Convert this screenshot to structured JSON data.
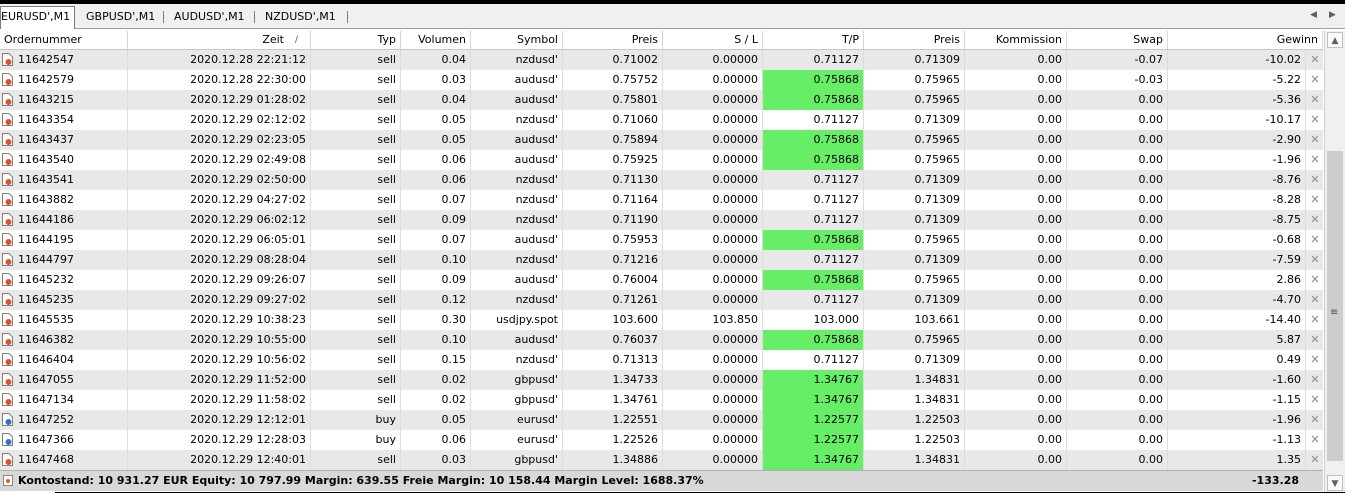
{
  "tabs": [
    {
      "label": "EURUSD',M1",
      "active": true
    },
    {
      "label": "GBPUSD',M1",
      "active": false
    },
    {
      "label": "AUDUSD',M1",
      "active": false
    },
    {
      "label": "NZDUSD',M1",
      "active": false
    }
  ],
  "columns": [
    "Ordernummer",
    "Zeit",
    "Typ",
    "Volumen",
    "Symbol",
    "Preis",
    "S / L",
    "T/P",
    "Preis",
    "Kommission",
    "Swap",
    "Gewinn"
  ],
  "sort_indicator": "/",
  "rows": [
    {
      "order": "11642547",
      "time": "2020.12.28 22:21:12",
      "type": "sell",
      "volume": "0.04",
      "symbol": "nzdusd'",
      "price": "0.71002",
      "sl": "0.00000",
      "tp": "0.71127",
      "tp_hit": false,
      "cur": "0.71309",
      "comm": "0.00",
      "swap": "-0.07",
      "profit": "-10.02",
      "icon": "red"
    },
    {
      "order": "11642579",
      "time": "2020.12.28 22:30:00",
      "type": "sell",
      "volume": "0.03",
      "symbol": "audusd'",
      "price": "0.75752",
      "sl": "0.00000",
      "tp": "0.75868",
      "tp_hit": true,
      "cur": "0.75965",
      "comm": "0.00",
      "swap": "-0.03",
      "profit": "-5.22",
      "icon": "red"
    },
    {
      "order": "11643215",
      "time": "2020.12.29 01:28:02",
      "type": "sell",
      "volume": "0.04",
      "symbol": "audusd'",
      "price": "0.75801",
      "sl": "0.00000",
      "tp": "0.75868",
      "tp_hit": true,
      "cur": "0.75965",
      "comm": "0.00",
      "swap": "0.00",
      "profit": "-5.36",
      "icon": "red"
    },
    {
      "order": "11643354",
      "time": "2020.12.29 02:12:02",
      "type": "sell",
      "volume": "0.05",
      "symbol": "nzdusd'",
      "price": "0.71060",
      "sl": "0.00000",
      "tp": "0.71127",
      "tp_hit": false,
      "cur": "0.71309",
      "comm": "0.00",
      "swap": "0.00",
      "profit": "-10.17",
      "icon": "red"
    },
    {
      "order": "11643437",
      "time": "2020.12.29 02:23:05",
      "type": "sell",
      "volume": "0.05",
      "symbol": "audusd'",
      "price": "0.75894",
      "sl": "0.00000",
      "tp": "0.75868",
      "tp_hit": true,
      "cur": "0.75965",
      "comm": "0.00",
      "swap": "0.00",
      "profit": "-2.90",
      "icon": "red"
    },
    {
      "order": "11643540",
      "time": "2020.12.29 02:49:08",
      "type": "sell",
      "volume": "0.06",
      "symbol": "audusd'",
      "price": "0.75925",
      "sl": "0.00000",
      "tp": "0.75868",
      "tp_hit": true,
      "cur": "0.75965",
      "comm": "0.00",
      "swap": "0.00",
      "profit": "-1.96",
      "icon": "red"
    },
    {
      "order": "11643541",
      "time": "2020.12.29 02:50:00",
      "type": "sell",
      "volume": "0.06",
      "symbol": "nzdusd'",
      "price": "0.71130",
      "sl": "0.00000",
      "tp": "0.71127",
      "tp_hit": false,
      "cur": "0.71309",
      "comm": "0.00",
      "swap": "0.00",
      "profit": "-8.76",
      "icon": "red"
    },
    {
      "order": "11643882",
      "time": "2020.12.29 04:27:02",
      "type": "sell",
      "volume": "0.07",
      "symbol": "nzdusd'",
      "price": "0.71164",
      "sl": "0.00000",
      "tp": "0.71127",
      "tp_hit": false,
      "cur": "0.71309",
      "comm": "0.00",
      "swap": "0.00",
      "profit": "-8.28",
      "icon": "red"
    },
    {
      "order": "11644186",
      "time": "2020.12.29 06:02:12",
      "type": "sell",
      "volume": "0.09",
      "symbol": "nzdusd'",
      "price": "0.71190",
      "sl": "0.00000",
      "tp": "0.71127",
      "tp_hit": false,
      "cur": "0.71309",
      "comm": "0.00",
      "swap": "0.00",
      "profit": "-8.75",
      "icon": "red"
    },
    {
      "order": "11644195",
      "time": "2020.12.29 06:05:01",
      "type": "sell",
      "volume": "0.07",
      "symbol": "audusd'",
      "price": "0.75953",
      "sl": "0.00000",
      "tp": "0.75868",
      "tp_hit": true,
      "cur": "0.75965",
      "comm": "0.00",
      "swap": "0.00",
      "profit": "-0.68",
      "icon": "red"
    },
    {
      "order": "11644797",
      "time": "2020.12.29 08:28:04",
      "type": "sell",
      "volume": "0.10",
      "symbol": "nzdusd'",
      "price": "0.71216",
      "sl": "0.00000",
      "tp": "0.71127",
      "tp_hit": false,
      "cur": "0.71309",
      "comm": "0.00",
      "swap": "0.00",
      "profit": "-7.59",
      "icon": "red"
    },
    {
      "order": "11645232",
      "time": "2020.12.29 09:26:07",
      "type": "sell",
      "volume": "0.09",
      "symbol": "audusd'",
      "price": "0.76004",
      "sl": "0.00000",
      "tp": "0.75868",
      "tp_hit": true,
      "cur": "0.75965",
      "comm": "0.00",
      "swap": "0.00",
      "profit": "2.86",
      "icon": "red"
    },
    {
      "order": "11645235",
      "time": "2020.12.29 09:27:02",
      "type": "sell",
      "volume": "0.12",
      "symbol": "nzdusd'",
      "price": "0.71261",
      "sl": "0.00000",
      "tp": "0.71127",
      "tp_hit": false,
      "cur": "0.71309",
      "comm": "0.00",
      "swap": "0.00",
      "profit": "-4.70",
      "icon": "red"
    },
    {
      "order": "11645535",
      "time": "2020.12.29 10:38:23",
      "type": "sell",
      "volume": "0.30",
      "symbol": "usdjpy.spot",
      "price": "103.600",
      "sl": "103.850",
      "tp": "103.000",
      "tp_hit": false,
      "cur": "103.661",
      "comm": "0.00",
      "swap": "0.00",
      "profit": "-14.40",
      "icon": "red"
    },
    {
      "order": "11646382",
      "time": "2020.12.29 10:55:00",
      "type": "sell",
      "volume": "0.10",
      "symbol": "audusd'",
      "price": "0.76037",
      "sl": "0.00000",
      "tp": "0.75868",
      "tp_hit": true,
      "cur": "0.75965",
      "comm": "0.00",
      "swap": "0.00",
      "profit": "5.87",
      "icon": "red"
    },
    {
      "order": "11646404",
      "time": "2020.12.29 10:56:02",
      "type": "sell",
      "volume": "0.15",
      "symbol": "nzdusd'",
      "price": "0.71313",
      "sl": "0.00000",
      "tp": "0.71127",
      "tp_hit": false,
      "cur": "0.71309",
      "comm": "0.00",
      "swap": "0.00",
      "profit": "0.49",
      "icon": "red"
    },
    {
      "order": "11647055",
      "time": "2020.12.29 11:52:00",
      "type": "sell",
      "volume": "0.02",
      "symbol": "gbpusd'",
      "price": "1.34733",
      "sl": "0.00000",
      "tp": "1.34767",
      "tp_hit": true,
      "cur": "1.34831",
      "comm": "0.00",
      "swap": "0.00",
      "profit": "-1.60",
      "icon": "red"
    },
    {
      "order": "11647134",
      "time": "2020.12.29 11:58:02",
      "type": "sell",
      "volume": "0.02",
      "symbol": "gbpusd'",
      "price": "1.34761",
      "sl": "0.00000",
      "tp": "1.34767",
      "tp_hit": true,
      "cur": "1.34831",
      "comm": "0.00",
      "swap": "0.00",
      "profit": "-1.15",
      "icon": "red"
    },
    {
      "order": "11647252",
      "time": "2020.12.29 12:12:01",
      "type": "buy",
      "volume": "0.05",
      "symbol": "eurusd'",
      "price": "1.22551",
      "sl": "0.00000",
      "tp": "1.22577",
      "tp_hit": true,
      "cur": "1.22503",
      "comm": "0.00",
      "swap": "0.00",
      "profit": "-1.96",
      "icon": "blue"
    },
    {
      "order": "11647366",
      "time": "2020.12.29 12:28:03",
      "type": "buy",
      "volume": "0.06",
      "symbol": "eurusd'",
      "price": "1.22526",
      "sl": "0.00000",
      "tp": "1.22577",
      "tp_hit": true,
      "cur": "1.22503",
      "comm": "0.00",
      "swap": "0.00",
      "profit": "-1.13",
      "icon": "blue"
    },
    {
      "order": "11647468",
      "time": "2020.12.29 12:40:01",
      "type": "sell",
      "volume": "0.03",
      "symbol": "gbpusd'",
      "price": "1.34886",
      "sl": "0.00000",
      "tp": "1.34767",
      "tp_hit": true,
      "cur": "1.34831",
      "comm": "0.00",
      "swap": "0.00",
      "profit": "1.35",
      "icon": "red"
    }
  ],
  "summary": {
    "text": "Kontostand: 10 931.27 EUR  Equity: 10 797.99  Margin: 639.55  Freie Margin: 10 158.44  Margin Level: 1688.37%",
    "total_profit": "-133.28"
  },
  "colors": {
    "tp_hit_highlight": "#66ee66",
    "row_alt": "#e8e8e8",
    "sell_icon": "#e05020",
    "buy_icon": "#3070d0"
  }
}
